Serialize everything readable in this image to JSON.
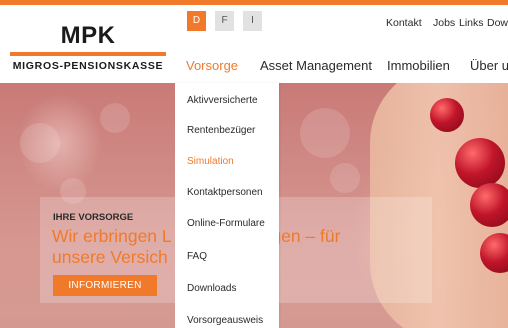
{
  "logo": {
    "mark": "MPK",
    "subtitle": "MIGROS-PENSIONSKASSE"
  },
  "languages": [
    {
      "label": "D",
      "active": true
    },
    {
      "label": "F",
      "active": false
    },
    {
      "label": "I",
      "active": false
    }
  ],
  "utility_links": [
    "Kontakt",
    "Jobs",
    "Links",
    "Dow"
  ],
  "nav": [
    {
      "label": "Vorsorge",
      "active": true
    },
    {
      "label": "Asset Management",
      "active": false
    },
    {
      "label": "Immobilien",
      "active": false
    },
    {
      "label": "Über ur",
      "active": false
    }
  ],
  "dropdown": [
    {
      "label": "Aktivversicherte",
      "active": false
    },
    {
      "label": "Rentenbezüger",
      "active": false
    },
    {
      "label": "Simulation",
      "active": true
    },
    {
      "label": "Kontaktpersonen",
      "active": false
    },
    {
      "label": "Online-Formulare",
      "active": false
    },
    {
      "label": "FAQ",
      "active": false
    },
    {
      "label": "Downloads",
      "active": false
    },
    {
      "label": "Vorsorgeausweis",
      "active": false
    }
  ],
  "hero": {
    "kicker": "IHRE VORSORGE",
    "headline_line1": "Wir erbringen L",
    "headline_line1_tail": "ngen – für",
    "headline_line2": "unsere Versich",
    "cta": "INFORMIEREN"
  },
  "colors": {
    "accent": "#f07a2a",
    "text": "#2a2a2a",
    "inactive_lang_bg": "#e2e2e2"
  }
}
